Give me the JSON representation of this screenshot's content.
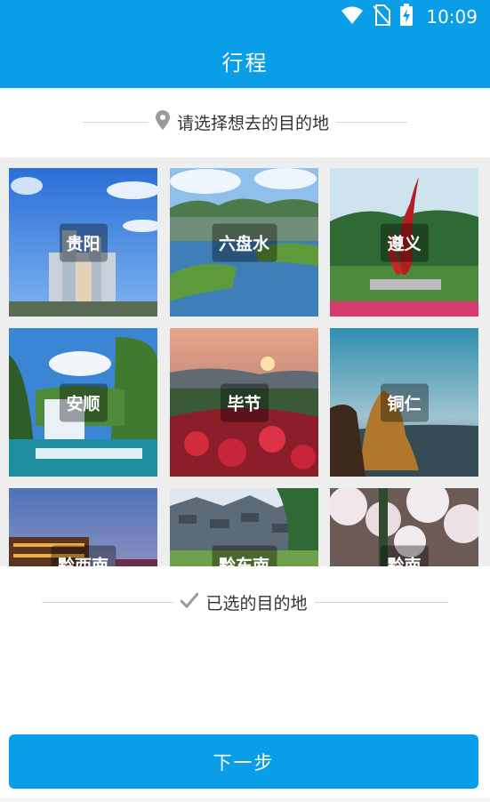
{
  "status_bar": {
    "time": "10:09"
  },
  "app_bar": {
    "title": "行程"
  },
  "choose_section": {
    "label": "请选择想去的目的地"
  },
  "destinations": [
    {
      "name": "贵阳"
    },
    {
      "name": "六盘水"
    },
    {
      "name": "遵义"
    },
    {
      "name": "安顺"
    },
    {
      "name": "毕节"
    },
    {
      "name": "铜仁"
    },
    {
      "name": "黔西南"
    },
    {
      "name": "黔东南"
    },
    {
      "name": "黔南"
    }
  ],
  "selected_section": {
    "label": "已选的目的地"
  },
  "next_button": {
    "label": "下一步"
  },
  "colors": {
    "primary": "#0a9ee8",
    "grid_bg": "#eeeeee"
  }
}
